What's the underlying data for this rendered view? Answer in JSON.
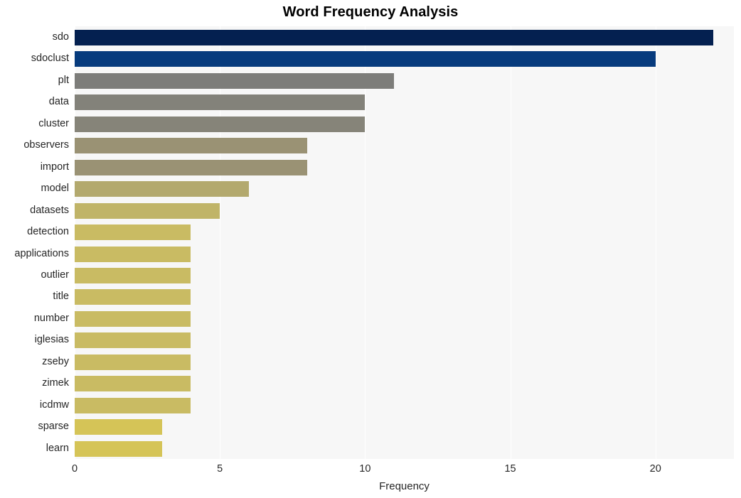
{
  "chart_data": {
    "type": "bar",
    "orientation": "horizontal",
    "title": "Word Frequency Analysis",
    "xlabel": "Frequency",
    "ylabel": "",
    "xlim": [
      0,
      22.7
    ],
    "ylim": [
      0,
      20
    ],
    "grid": true,
    "legend": null,
    "xticks": [
      "0",
      "5",
      "10",
      "15",
      "20"
    ],
    "xtick_values": [
      0,
      5,
      10,
      15,
      20
    ],
    "categories": [
      "sdo",
      "sdoclust",
      "plt",
      "data",
      "cluster",
      "observers",
      "import",
      "model",
      "datasets",
      "detection",
      "applications",
      "outlier",
      "title",
      "number",
      "iglesias",
      "zseby",
      "zimek",
      "icdmw",
      "sparse",
      "learn"
    ],
    "values": [
      22,
      20,
      11,
      10,
      10,
      8,
      8,
      6,
      5,
      4,
      4,
      4,
      4,
      4,
      4,
      4,
      4,
      4,
      3,
      3
    ],
    "colors": [
      "#042050",
      "#073b7d",
      "#7d7d7a",
      "#83827a",
      "#868479",
      "#9a9274",
      "#9a9274",
      "#b3a96e",
      "#c0b468",
      "#c9bb63",
      "#c9bb63",
      "#c9bb63",
      "#c9bb63",
      "#c9bb63",
      "#c9bb63",
      "#c9bb63",
      "#c9bb63",
      "#c9bb63",
      "#d5c457",
      "#d5c457"
    ],
    "plot_background": "#f7f7f7",
    "gridline_color": "#ffffff",
    "figure_background": "#ffffff"
  }
}
